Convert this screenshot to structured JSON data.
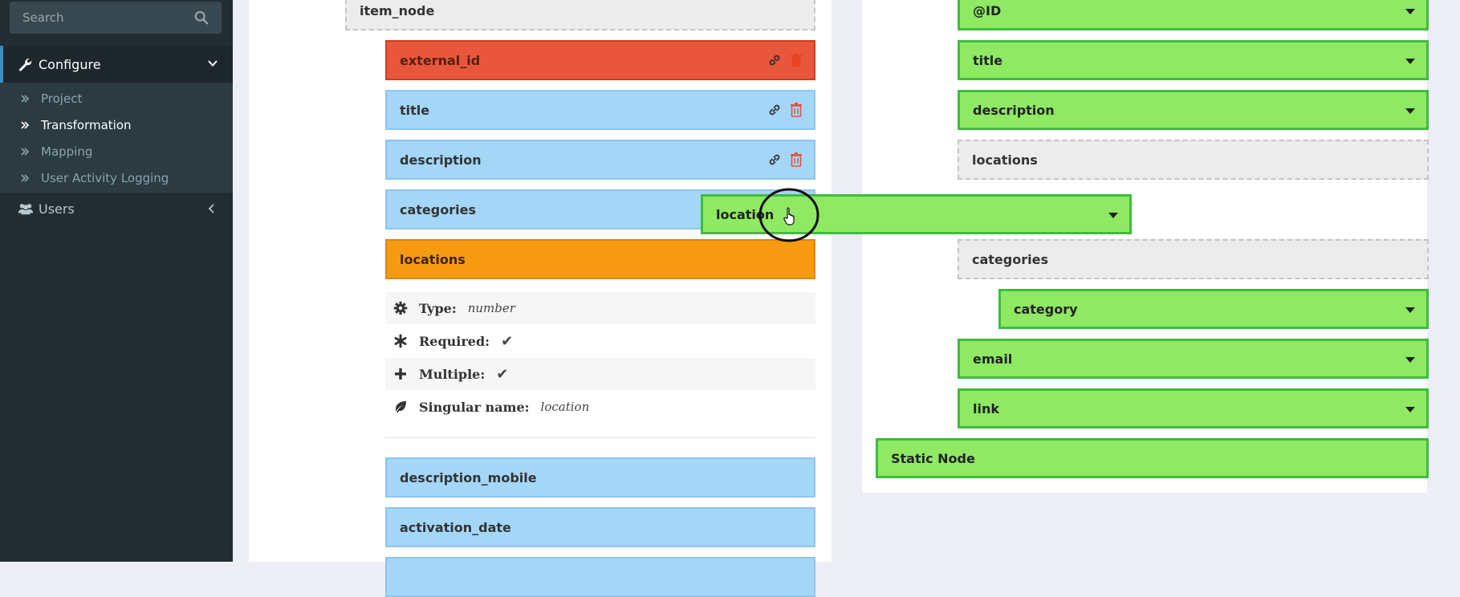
{
  "sidebar": {
    "search_placeholder": "Search",
    "configure_label": "Configure",
    "submenu": [
      {
        "label": "Project"
      },
      {
        "label": "Transformation"
      },
      {
        "label": "Mapping"
      },
      {
        "label": "User Activity Logging"
      }
    ],
    "users_label": "Users"
  },
  "left_tree": {
    "parent": "item_node",
    "fields": [
      {
        "label": "external_id",
        "color": "#e8573b"
      },
      {
        "label": "title",
        "color": "#a4d6f8"
      },
      {
        "label": "description",
        "color": "#a4d6f8"
      },
      {
        "label": "categories",
        "color": "#a4d6f8"
      },
      {
        "label": "locations",
        "color": "#f79a12"
      }
    ],
    "details": {
      "type_key": "Type:",
      "type_value": "number",
      "required_key": "Required:",
      "required_value": "✔",
      "multiple_key": "Multiple:",
      "multiple_value": "✔",
      "singular_key": "Singular name:",
      "singular_value": "location"
    },
    "more_fields": [
      {
        "label": "description_mobile"
      },
      {
        "label": "activation_date"
      }
    ]
  },
  "right_tree": {
    "nodes": [
      {
        "label": "@ID"
      },
      {
        "label": "title"
      },
      {
        "label": "description"
      },
      {
        "label": "locations"
      },
      {
        "label": "categories"
      },
      {
        "label": "category"
      },
      {
        "label": "email"
      },
      {
        "label": "link"
      },
      {
        "label": "Static Node"
      }
    ]
  },
  "dragged_node": {
    "label": "location"
  },
  "colors": {
    "accent_green": "#8fe963",
    "green_border": "#3fbc3f",
    "sidebar_bg": "#222d32"
  }
}
